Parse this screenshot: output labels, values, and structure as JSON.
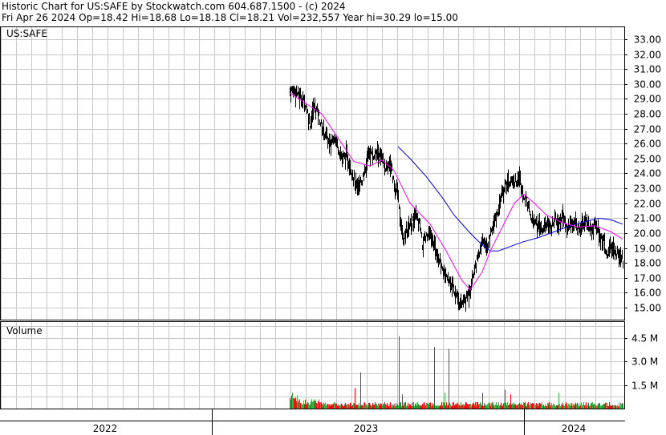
{
  "header": {
    "title_line": "Historic Chart for US:SAFE by Stockwatch.com 604.687.1500 - (c) 2024",
    "quote_line": "Fri Apr 26 2024   Op=18.42   Hi=18.68   Lo=18.18   Cl=18.21   Vol=232,557   Year hi=30.29   lo=15.00"
  },
  "chart_data": [
    {
      "type": "candlestick",
      "title": "US:SAFE",
      "y_ticks": [
        "33.00",
        "32.00",
        "31.00",
        "30.00",
        "29.00",
        "28.00",
        "27.00",
        "26.00",
        "25.00",
        "24.00",
        "23.00",
        "22.00",
        "21.00",
        "20.00",
        "19.00",
        "18.00",
        "17.00",
        "16.00",
        "15.00"
      ],
      "ylim": [
        14.2,
        33.8
      ],
      "grid": true,
      "x_labels": [
        "2022",
        "2023",
        "2024"
      ],
      "bar_color": "#000000",
      "anchor_points": [
        [
          0,
          29.5
        ],
        [
          5,
          29.6
        ],
        [
          10,
          29.3
        ],
        [
          15,
          29.0
        ],
        [
          20,
          28.6
        ],
        [
          25,
          27.3
        ],
        [
          30,
          28.5
        ],
        [
          35,
          28.1
        ],
        [
          40,
          27.0
        ],
        [
          45,
          26.6
        ],
        [
          50,
          25.8
        ],
        [
          55,
          26.6
        ],
        [
          60,
          25.8
        ],
        [
          65,
          25.0
        ],
        [
          70,
          25.2
        ],
        [
          75,
          24.5
        ],
        [
          80,
          23.6
        ],
        [
          85,
          22.8
        ],
        [
          90,
          23.6
        ],
        [
          95,
          24.6
        ],
        [
          100,
          25.4
        ],
        [
          105,
          25.1
        ],
        [
          110,
          25.4
        ],
        [
          115,
          24.8
        ],
        [
          120,
          24.3
        ],
        [
          125,
          24.8
        ],
        [
          130,
          23.1
        ],
        [
          135,
          22.6
        ],
        [
          138,
          20.5
        ],
        [
          142,
          19.6
        ],
        [
          147,
          20.2
        ],
        [
          152,
          20.6
        ],
        [
          157,
          21.1
        ],
        [
          162,
          20.4
        ],
        [
          165,
          19.2
        ],
        [
          170,
          19.7
        ],
        [
          175,
          19.8
        ],
        [
          180,
          19.2
        ],
        [
          185,
          18.3
        ],
        [
          190,
          17.6
        ],
        [
          195,
          17.0
        ],
        [
          200,
          16.6
        ],
        [
          205,
          16.2
        ],
        [
          210,
          15.6
        ],
        [
          213,
          15.1
        ],
        [
          216,
          15.4
        ],
        [
          220,
          15.6
        ],
        [
          225,
          16.4
        ],
        [
          230,
          17.6
        ],
        [
          235,
          18.4
        ],
        [
          240,
          19.4
        ],
        [
          245,
          19.0
        ],
        [
          250,
          19.8
        ],
        [
          255,
          20.8
        ],
        [
          260,
          21.6
        ],
        [
          265,
          22.8
        ],
        [
          270,
          23.2
        ],
        [
          275,
          23.6
        ],
        [
          280,
          23.4
        ],
        [
          285,
          23.8
        ],
        [
          290,
          22.8
        ],
        [
          295,
          22.2
        ],
        [
          300,
          21.1
        ],
        [
          305,
          20.8
        ],
        [
          310,
          20.4
        ],
        [
          315,
          20.1
        ],
        [
          320,
          20.6
        ],
        [
          325,
          20.2
        ],
        [
          330,
          20.9
        ],
        [
          335,
          20.6
        ],
        [
          340,
          21.1
        ],
        [
          345,
          20.3
        ],
        [
          350,
          20.7
        ],
        [
          355,
          20.6
        ],
        [
          360,
          20.3
        ],
        [
          365,
          20.6
        ],
        [
          370,
          20.8
        ],
        [
          375,
          20.1
        ],
        [
          380,
          20.6
        ],
        [
          385,
          20.0
        ],
        [
          390,
          19.6
        ],
        [
          395,
          18.6
        ],
        [
          400,
          19.0
        ],
        [
          405,
          18.7
        ],
        [
          410,
          18.5
        ],
        [
          415,
          18.21
        ]
      ],
      "moving_average_short": {
        "color": "#ff00ff",
        "points": [
          [
            0,
            29.4
          ],
          [
            40,
            28.0
          ],
          [
            65,
            26.0
          ],
          [
            80,
            24.8
          ],
          [
            100,
            24.5
          ],
          [
            115,
            24.9
          ],
          [
            130,
            24.2
          ],
          [
            150,
            22.0
          ],
          [
            175,
            20.6
          ],
          [
            195,
            18.8
          ],
          [
            215,
            16.8
          ],
          [
            225,
            16.2
          ],
          [
            240,
            17.4
          ],
          [
            250,
            18.8
          ],
          [
            265,
            20.4
          ],
          [
            280,
            22.0
          ],
          [
            292,
            22.6
          ],
          [
            305,
            22.0
          ],
          [
            320,
            21.2
          ],
          [
            340,
            20.7
          ],
          [
            360,
            20.4
          ],
          [
            380,
            20.5
          ],
          [
            400,
            20.1
          ],
          [
            415,
            19.6
          ]
        ]
      },
      "moving_average_long": {
        "color": "#0000dd",
        "points": [
          [
            135,
            25.8
          ],
          [
            150,
            25.0
          ],
          [
            170,
            23.8
          ],
          [
            190,
            22.4
          ],
          [
            205,
            21.2
          ],
          [
            225,
            20.0
          ],
          [
            240,
            19.2
          ],
          [
            250,
            18.8
          ],
          [
            260,
            18.8
          ],
          [
            275,
            19.1
          ],
          [
            290,
            19.4
          ],
          [
            310,
            19.7
          ],
          [
            330,
            20.1
          ],
          [
            350,
            20.5
          ],
          [
            370,
            20.8
          ],
          [
            385,
            21.0
          ],
          [
            400,
            20.9
          ],
          [
            415,
            20.6
          ]
        ]
      }
    },
    {
      "type": "bar",
      "title": "Volume",
      "y_ticks": [
        "4.5 M",
        "3.0 M",
        "1.5 M"
      ],
      "ylim": [
        0,
        5.5
      ],
      "up_color": "#3cb043",
      "down_color": "#ee1111",
      "spikes": [
        {
          "index": 81,
          "value": 1.3,
          "color": "#ee1111"
        },
        {
          "index": 88,
          "value": 2.3,
          "color": "#ee1111"
        },
        {
          "index": 136,
          "value": 4.6,
          "color": "#ee1111"
        },
        {
          "index": 140,
          "value": 0.9,
          "color": "#ee1111"
        },
        {
          "index": 180,
          "value": 3.9,
          "color": "#ee1111"
        },
        {
          "index": 193,
          "value": 1.0,
          "color": "#3cb043"
        },
        {
          "index": 198,
          "value": 3.8,
          "color": "#ee1111"
        },
        {
          "index": 240,
          "value": 1.0,
          "color": "#ee1111"
        },
        {
          "index": 268,
          "value": 1.2,
          "color": "#ee1111"
        },
        {
          "index": 275,
          "value": 0.9,
          "color": "#ee1111"
        },
        {
          "index": 335,
          "value": 1.0,
          "color": "#3cb043"
        }
      ]
    }
  ]
}
